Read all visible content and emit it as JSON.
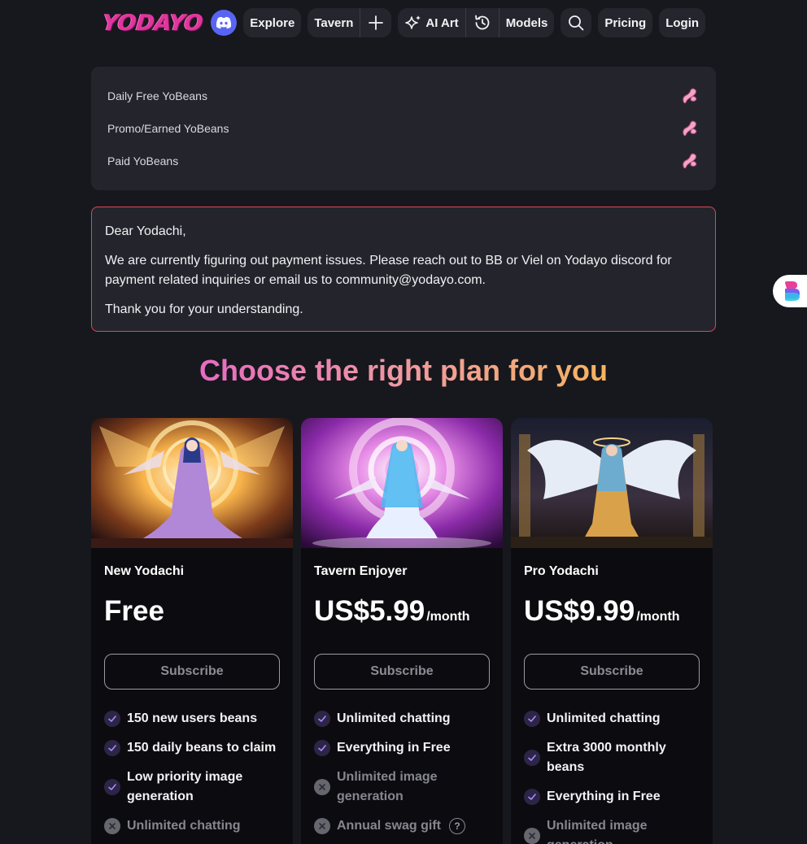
{
  "nav": {
    "logo": "YODAYO",
    "explore": "Explore",
    "tavern": "Tavern",
    "ai_art": "AI Art",
    "models": "Models",
    "pricing": "Pricing",
    "login": "Login"
  },
  "beans": {
    "items": [
      {
        "label": "Daily Free YoBeans"
      },
      {
        "label": "Promo/Earned YoBeans"
      },
      {
        "label": "Paid YoBeans"
      }
    ]
  },
  "notice": {
    "greeting": "Dear Yodachi,",
    "body": "We are currently figuring out payment issues. Please reach out to BB or Viel on Yodayo discord for payment related inquiries or email us to community@yodayo.com.",
    "closing": "Thank you for your understanding."
  },
  "headline": "Choose the right plan for you",
  "plans": [
    {
      "name": "New Yodachi",
      "price": "Free",
      "unit": "",
      "subscribe": "Subscribe",
      "features": [
        {
          "text": "150 new users beans",
          "included": true
        },
        {
          "text": "150 daily beans to claim",
          "included": true
        },
        {
          "text": "Low priority image generation",
          "included": true
        },
        {
          "text": "Unlimited chatting",
          "included": false
        }
      ]
    },
    {
      "name": "Tavern Enjoyer",
      "price": "US$5.99",
      "unit": "/month",
      "subscribe": "Subscribe",
      "features": [
        {
          "text": "Unlimited chatting",
          "included": true
        },
        {
          "text": "Everything in Free",
          "included": true
        },
        {
          "text": "Unlimited image generation",
          "included": false
        },
        {
          "text": "Annual swag gift",
          "included": false
        }
      ]
    },
    {
      "name": "Pro Yodachi",
      "price": "US$9.99",
      "unit": "/month",
      "subscribe": "Subscribe",
      "features": [
        {
          "text": "Unlimited chatting",
          "included": true
        },
        {
          "text": "Extra 3000 monthly beans",
          "included": true
        },
        {
          "text": "Everything in Free",
          "included": true
        },
        {
          "text": "Unlimited image generation",
          "included": false
        }
      ]
    }
  ],
  "colors": {
    "background": "#17181d",
    "panel": "#24252c",
    "notice_border": "#d9485a",
    "brand_pink": "#e1359d",
    "discord": "#5865f2",
    "check_purple": "#8b6cf0"
  },
  "icons": [
    "discord-icon",
    "plus-icon",
    "sparkle-icon",
    "history-icon",
    "search-icon",
    "bean-icon",
    "check-icon",
    "cross-icon",
    "help-icon"
  ]
}
